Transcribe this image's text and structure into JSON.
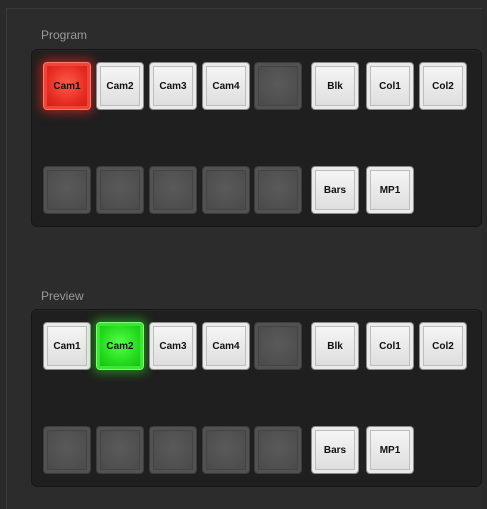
{
  "program": {
    "title": "Program",
    "row1": [
      "Cam1",
      "Cam2",
      "Cam3",
      "Cam4",
      "",
      "Blk",
      "Col1",
      "Col2"
    ],
    "row2": [
      "",
      "",
      "",
      "",
      "",
      "Bars",
      "MP1"
    ],
    "active": "Cam1",
    "active_color": "#e52a20"
  },
  "preview": {
    "title": "Preview",
    "row1": [
      "Cam1",
      "Cam2",
      "Cam3",
      "Cam4",
      "",
      "Blk",
      "Col1",
      "Col2"
    ],
    "row2": [
      "",
      "",
      "",
      "",
      "",
      "Bars",
      "MP1"
    ],
    "active": "Cam2",
    "active_color": "#21d81a"
  },
  "icons": {
    "unassigned_button": "blank-square"
  }
}
